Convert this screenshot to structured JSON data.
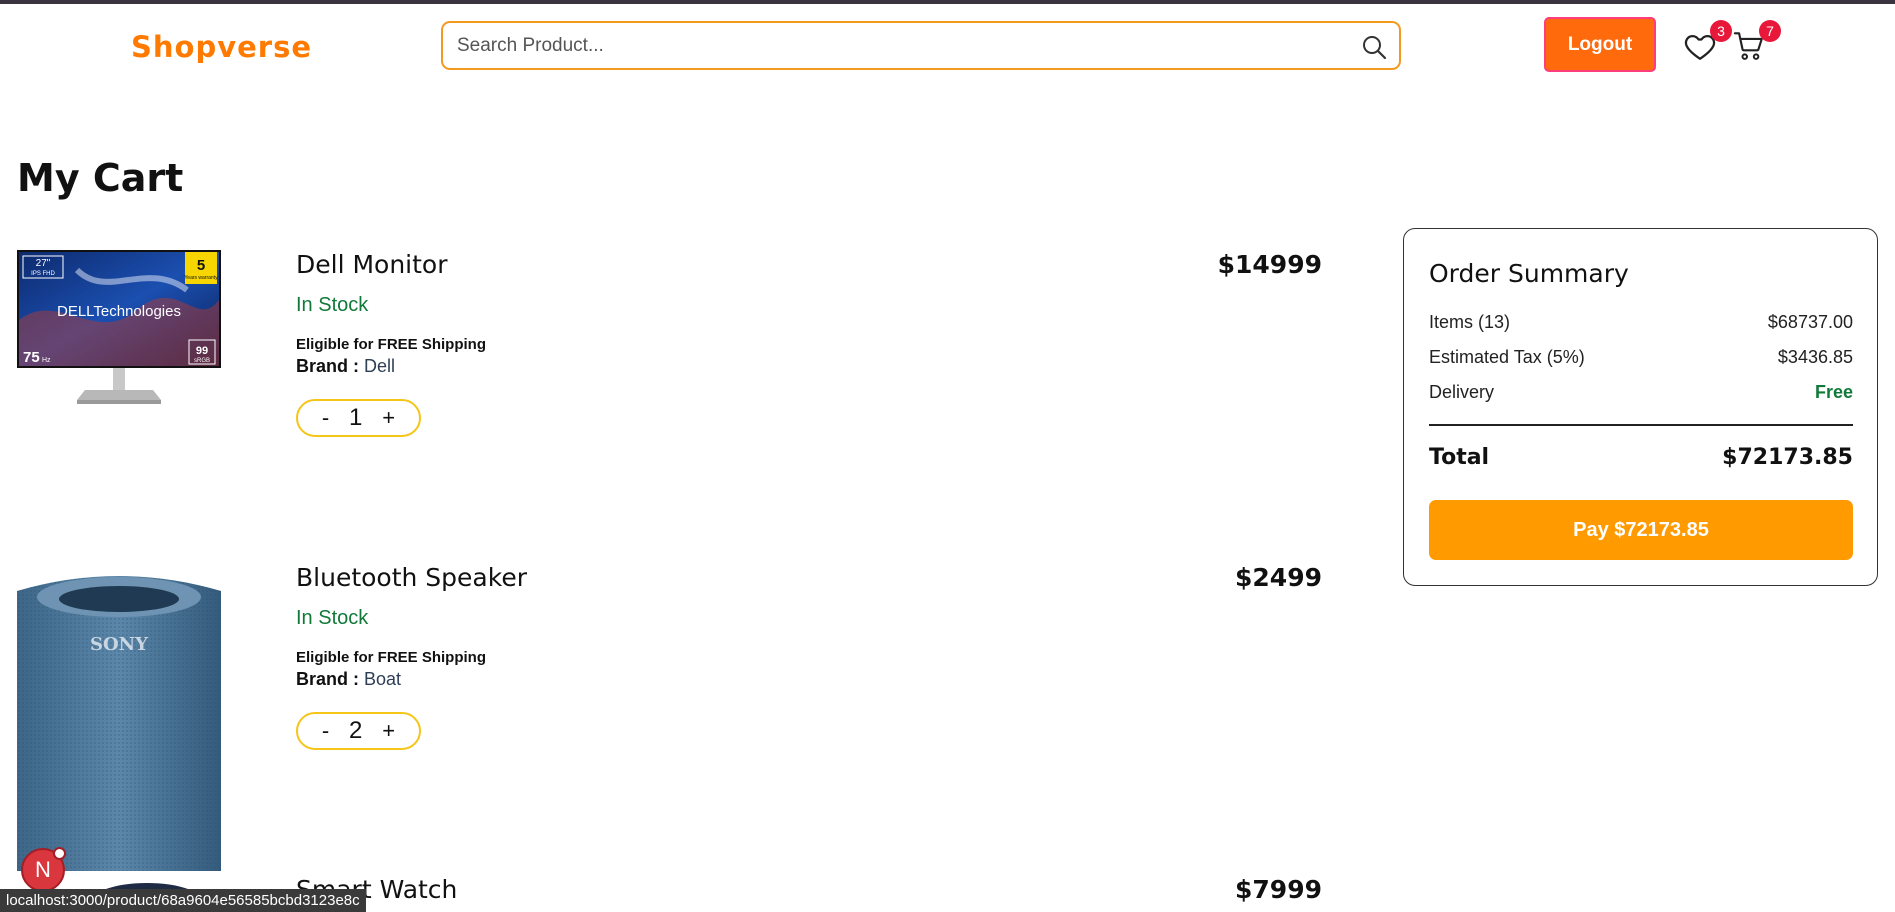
{
  "header": {
    "brand": "Shopverse",
    "search_placeholder": "Search Product...",
    "logout_label": "Logout",
    "wishlist_count": "3",
    "cart_count": "7"
  },
  "page": {
    "title": "My Cart"
  },
  "cart_items": [
    {
      "name": "Dell Monitor",
      "stock": "In Stock",
      "shipping": "Eligible for FREE Shipping",
      "brand_label": "Brand :",
      "brand": "Dell",
      "price": "$14999",
      "quantity": "1",
      "image_icon": "dell-monitor-image"
    },
    {
      "name": "Bluetooth Speaker",
      "stock": "In Stock",
      "shipping": "Eligible for FREE Shipping",
      "brand_label": "Brand :",
      "brand": "Boat",
      "price": "$2499",
      "quantity": "2",
      "image_icon": "sony-speaker-image"
    },
    {
      "name": "Smart Watch",
      "price": "$7999"
    }
  ],
  "qty_controls": {
    "minus": "-",
    "plus": "+"
  },
  "summary": {
    "title": "Order Summary",
    "items_label": "Items (13)",
    "items_value": "$68737.00",
    "tax_label": "Estimated Tax (5%)",
    "tax_value": "$3436.85",
    "delivery_label": "Delivery",
    "delivery_value": "Free",
    "total_label": "Total",
    "total_value": "$72173.85",
    "pay_label": "Pay $72173.85"
  },
  "status_bar": {
    "url": "localhost:3000/product/68a9604e56585bcbd3123e8c"
  },
  "floating_avatar": {
    "letter": "N"
  },
  "image_text": {
    "monitor_brand": "DELLTechnologies",
    "monitor_size": "27\"",
    "monitor_panel": "IPS FHD",
    "monitor_warranty_number": "5",
    "monitor_warranty_text": "Years warranty",
    "monitor_refresh": "75",
    "monitor_refresh_unit": "Hz",
    "monitor_srgb_value": "99",
    "monitor_srgb_label": "sRGB",
    "speaker_brand": "SONY"
  },
  "colors": {
    "brand": "#ff7a00",
    "logout_bg": "#ff6a0d",
    "pay_bg": "#ff9a00",
    "stock_green": "#117a3a",
    "badge_red": "#e8183a",
    "qty_border": "#f5c518"
  }
}
